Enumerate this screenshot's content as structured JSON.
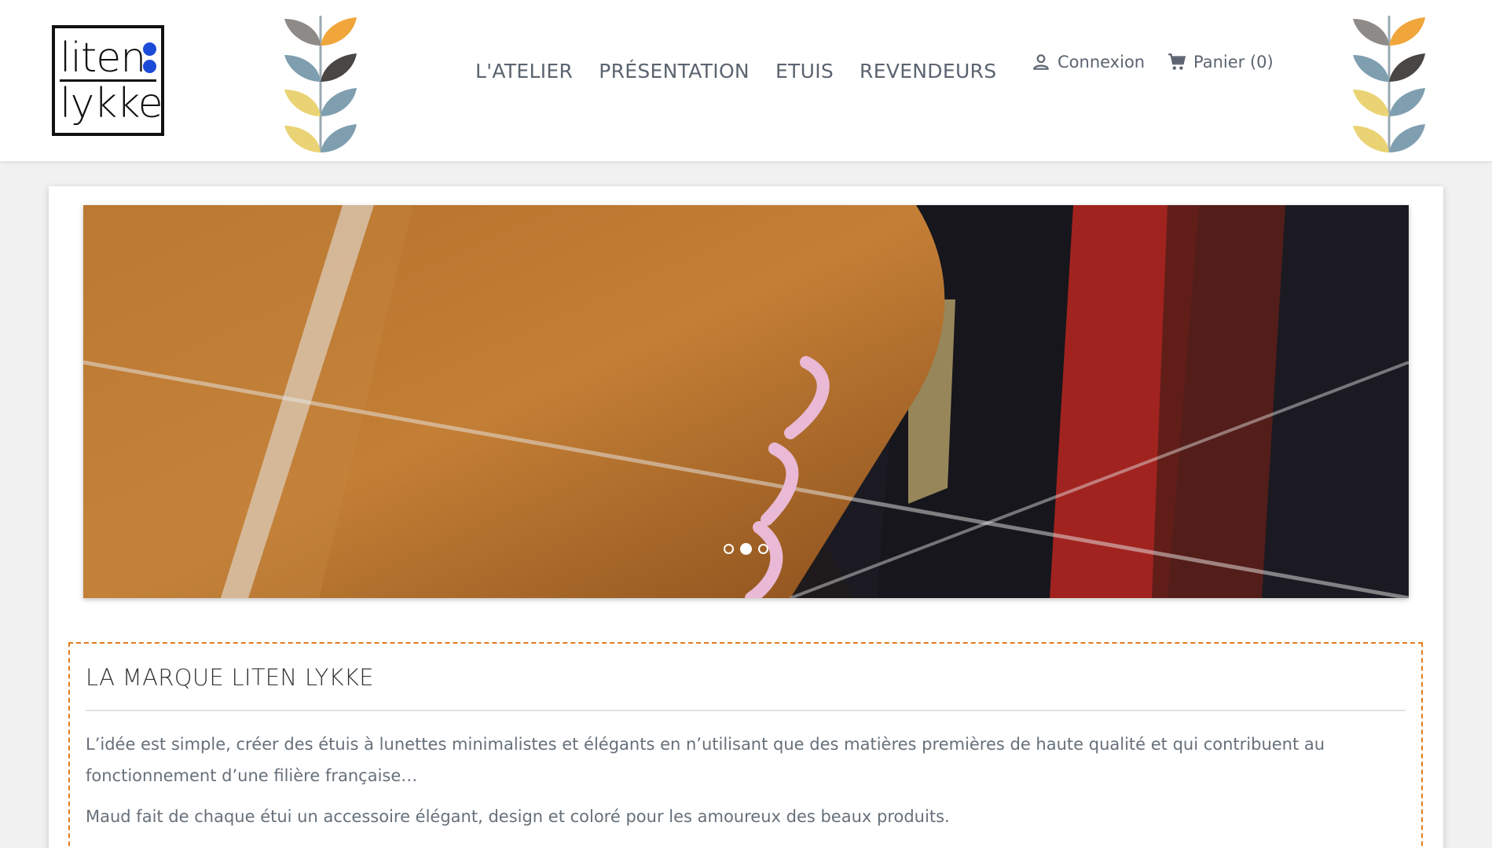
{
  "header": {
    "logo": {
      "line1": "liten",
      "line2": "lykke"
    },
    "nav": [
      "L'ATELIER",
      "PRÉSENTATION",
      "ETUIS",
      "REVENDEURS"
    ],
    "account_label": "Connexion",
    "cart_label": "Panier (0)"
  },
  "slider": {
    "slide_count": 3,
    "active_index": 1
  },
  "brand": {
    "title": "LA MARQUE LITEN LYKKE",
    "paragraph1": "L’idée est simple, créer des étuis à lunettes minimalistes et élégants en n’utilisant que des matières premières de haute qualité et qui contribuent au fonctionnement d’une filière française…",
    "paragraph2": "Maud fait de chaque étui un accessoire élégant, design et coloré pour les amoureux des beaux produits."
  },
  "colors": {
    "accent_border": "#e07d1c",
    "logo_dot": "#1c4bd9",
    "leaf_orange": "#f0a63a",
    "leaf_grey": "#8d8a88",
    "leaf_blue": "#7f9fb0",
    "leaf_dark": "#4a4644",
    "leaf_yellow": "#ead374"
  },
  "icons": {
    "account": "user-icon",
    "cart": "cart-icon",
    "branch": "leaf-branch-icon"
  }
}
